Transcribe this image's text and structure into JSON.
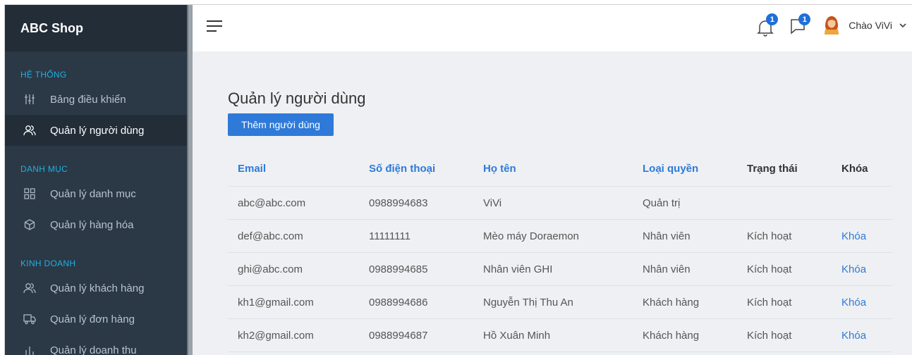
{
  "sidebar": {
    "brand": "ABC Shop",
    "sections": [
      {
        "title": "HỆ THỐNG"
      },
      {
        "title": "DANH MỤC"
      },
      {
        "title": "KINH DOANH"
      }
    ],
    "items": [
      {
        "label": "Bảng điều khiển",
        "icon": "sliders-icon"
      },
      {
        "label": "Quản lý người dùng",
        "icon": "users-icon"
      },
      {
        "label": "Quản lý danh mục",
        "icon": "grid-icon"
      },
      {
        "label": "Quản lý hàng hóa",
        "icon": "box-icon"
      },
      {
        "label": "Quản lý khách hàng",
        "icon": "users-icon"
      },
      {
        "label": "Quản lý đơn hàng",
        "icon": "truck-icon"
      },
      {
        "label": "Quản lý doanh thu",
        "icon": "chart-icon"
      }
    ]
  },
  "topbar": {
    "notifications_count": "1",
    "messages_count": "1",
    "user_greeting": "Chào ViVi"
  },
  "main": {
    "title": "Quản lý người dùng",
    "add_button": "Thêm người dùng",
    "table": {
      "headers": [
        "Email",
        "Số điện thoại",
        "Họ tên",
        "Loại quyền",
        "Trạng thái",
        "Khóa"
      ],
      "rows": [
        [
          "abc@abc.com",
          "0988994683",
          "ViVi",
          "Quản trị",
          "",
          ""
        ],
        [
          "def@abc.com",
          "11111111",
          "Mèo máy Doraemon",
          "Nhân viên",
          "Kích hoạt",
          "Khóa"
        ],
        [
          "ghi@abc.com",
          "0988994685",
          "Nhân viên GHI",
          "Nhân viên",
          "Kích hoạt",
          "Khóa"
        ],
        [
          "kh1@gmail.com",
          "0988994686",
          "Nguyễn Thị Thu An",
          "Khách hàng",
          "Kích hoạt",
          "Khóa"
        ],
        [
          "kh2@gmail.com",
          "0988994687",
          "Hồ Xuân Minh",
          "Khách hàng",
          "Kích hoạt",
          "Khóa"
        ]
      ]
    }
  },
  "colors": {
    "sidebar_bg": "#2b3846",
    "accent": "#2f7ad8",
    "section_title": "#22b0e0"
  }
}
